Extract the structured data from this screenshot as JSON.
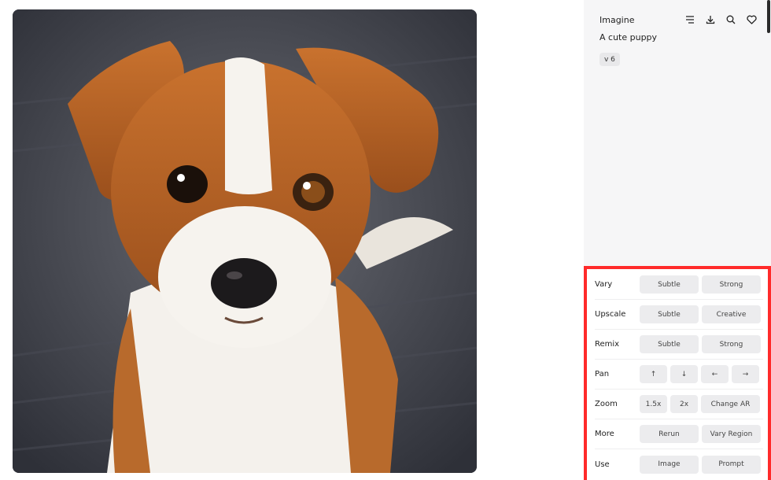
{
  "header": {
    "title": "Imagine"
  },
  "icons": {
    "menu": "menu-lines-icon",
    "download": "download-icon",
    "search": "search-icon",
    "favorite": "heart-icon"
  },
  "prompt": {
    "text": "A cute puppy"
  },
  "version": {
    "label": "v 6"
  },
  "highlight_color": "#ff2a2a",
  "actions": {
    "vary": {
      "label": "Vary",
      "buttons": [
        "Subtle",
        "Strong"
      ]
    },
    "upscale": {
      "label": "Upscale",
      "buttons": [
        "Subtle",
        "Creative"
      ]
    },
    "remix": {
      "label": "Remix",
      "buttons": [
        "Subtle",
        "Strong"
      ]
    },
    "pan": {
      "label": "Pan",
      "buttons": [
        "↑",
        "↓",
        "←",
        "→"
      ]
    },
    "zoom": {
      "label": "Zoom",
      "buttons": [
        "1.5x",
        "2x",
        "Change AR"
      ]
    },
    "more": {
      "label": "More",
      "buttons": [
        "Rerun",
        "Vary Region"
      ]
    },
    "use": {
      "label": "Use",
      "buttons": [
        "Image",
        "Prompt"
      ]
    }
  }
}
